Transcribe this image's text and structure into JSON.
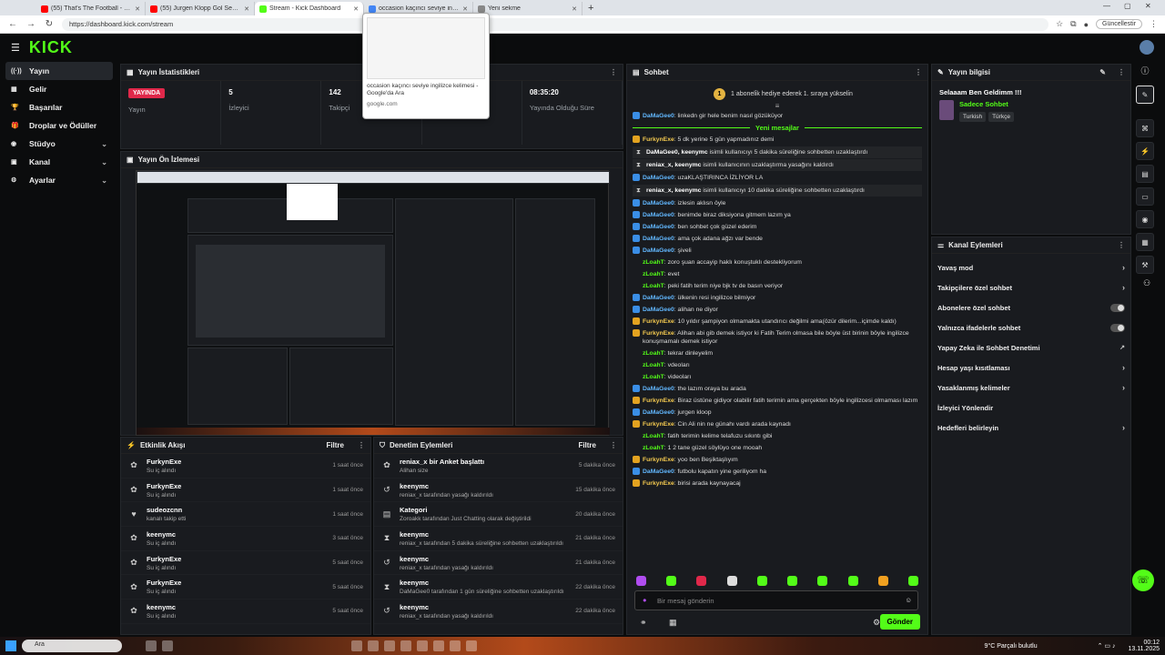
{
  "browser": {
    "tabs": [
      {
        "title": "(55) That's The Football - Fatih Te...",
        "color": "#ff0000",
        "active": false
      },
      {
        "title": "(55) Jurgen Klopp Gol Sevinci #kl...",
        "color": "#ff0000",
        "active": false
      },
      {
        "title": "Stream - Kick Dashboard",
        "color": "#53fc18",
        "active": true
      },
      {
        "title": "occasion kaçıncı seviye ingilizce k...",
        "color": "#4285f4",
        "active": false
      },
      {
        "title": "Yeni sekme",
        "color": "#888888",
        "active": false
      }
    ],
    "url": "https://dashboard.kick.com/stream",
    "update_label": "Güncellestir",
    "hover_card": {
      "title": "occasion kaçıncı seviye ingilizce kelimesi - Google'da Ara",
      "domain": "google.com"
    }
  },
  "brand": {
    "logo": "KICK",
    "accent": "#53fc18"
  },
  "sidebar": {
    "items": [
      {
        "label": "Yayın",
        "icon": "broadcast-icon",
        "glyph": "((·))",
        "active": true,
        "chev": ""
      },
      {
        "label": "Gelir",
        "icon": "revenue-icon",
        "glyph": "▦",
        "active": false,
        "chev": ""
      },
      {
        "label": "Başarılar",
        "icon": "trophy-icon",
        "glyph": "🏆",
        "active": false,
        "chev": ""
      },
      {
        "label": "Droplar ve Ödüller",
        "icon": "gift-icon",
        "glyph": "🎁",
        "active": false,
        "chev": ""
      },
      {
        "label": "Stüdyo",
        "icon": "studio-icon",
        "glyph": "◉",
        "active": false,
        "chev": "⌄"
      },
      {
        "label": "Kanal",
        "icon": "channel-icon",
        "glyph": "▣",
        "active": false,
        "chev": "⌄"
      },
      {
        "label": "Ayarlar",
        "icon": "settings-icon",
        "glyph": "⚙",
        "active": false,
        "chev": "⌄"
      }
    ]
  },
  "stats_panel": {
    "title": "Yayın İstatistikleri",
    "live_badge": "YAYINDA",
    "items": [
      {
        "value": "",
        "label": "Yayın"
      },
      {
        "value": "5",
        "label": "İzleyici"
      },
      {
        "value": "142",
        "label": "Takipçi"
      },
      {
        "value": "",
        "label": ""
      },
      {
        "value": "08:35:20",
        "label": "Yayında Olduğu Süre"
      }
    ]
  },
  "preview_panel": {
    "title": "Yayın Ön İzlemesi"
  },
  "activity_panel": {
    "title": "Etkinlik Akışı",
    "filter": "Filtre",
    "rows": [
      {
        "name": "FurkynExe",
        "detail": "Su iç alındı",
        "time": "1 saat önce",
        "icon": "reward-icon",
        "glyph": "✿"
      },
      {
        "name": "FurkynExe",
        "detail": "Su iç alındı",
        "time": "1 saat önce",
        "icon": "reward-icon",
        "glyph": "✿"
      },
      {
        "name": "sudeozcnn",
        "detail": "kanalı takip etti",
        "time": "1 saat önce",
        "icon": "heart-icon",
        "glyph": "♥"
      },
      {
        "name": "keenymc",
        "detail": "Su iç alındı",
        "time": "3 saat önce",
        "icon": "reward-icon",
        "glyph": "✿"
      },
      {
        "name": "FurkynExe",
        "detail": "Su iç alındı",
        "time": "5 saat önce",
        "icon": "reward-icon",
        "glyph": "✿"
      },
      {
        "name": "FurkynExe",
        "detail": "Su iç alındı",
        "time": "5 saat önce",
        "icon": "reward-icon",
        "glyph": "✿"
      },
      {
        "name": "keenymc",
        "detail": "Su iç alındı",
        "time": "5 saat önce",
        "icon": "reward-icon",
        "glyph": "✿"
      }
    ]
  },
  "moderation_panel": {
    "title": "Denetim Eylemleri",
    "filter": "Filtre",
    "rows": [
      {
        "name": "reniax_x bir Anket başlattı",
        "detail": "Alihan size",
        "time": "5 dakika önce",
        "icon": "poll-icon",
        "glyph": "✿"
      },
      {
        "name": "keenymc",
        "detail": "reniax_x tarafından yasağı kaldırıldı",
        "time": "15 dakika önce",
        "icon": "unban-icon",
        "glyph": "↺"
      },
      {
        "name": "Kategori",
        "detail": "Zoroakk tarafından Just Chatting olarak değiştirildi",
        "time": "20 dakika önce",
        "icon": "category-icon",
        "glyph": "▤"
      },
      {
        "name": "keenymc",
        "detail": "reniax_x tarafından 5 dakika süreliğine sohbetten uzaklaştırıldı",
        "time": "21 dakika önce",
        "icon": "timeout-icon",
        "glyph": "⧗"
      },
      {
        "name": "keenymc",
        "detail": "reniax_x tarafından yasağı kaldırıldı",
        "time": "21 dakika önce",
        "icon": "unban-icon",
        "glyph": "↺"
      },
      {
        "name": "keenymc",
        "detail": "DaMaGee0 tarafından 1 gün süreliğine sohbetten uzaklaştırıldı",
        "time": "22 dakika önce",
        "icon": "timeout-icon",
        "glyph": "⧗"
      },
      {
        "name": "keenymc",
        "detail": "reniax_x tarafından yasağı kaldırıldı",
        "time": "22 dakika önce",
        "icon": "unban-icon",
        "glyph": "↺"
      }
    ]
  },
  "chat_panel": {
    "title": "Sohbet",
    "banner": "1 aboneli̇k hediye ederek 1. sıraya yükseli̇n",
    "banner_num": "1",
    "new_messages": "Yeni mesajlar",
    "input_placeholder": "Bir mesaj gönderin",
    "send_label": "Gönder",
    "messages_before": [
      {
        "user": "DaMaGee0",
        "text": "linkedn gir hele benim nasıl gözüküyor",
        "style": "blue",
        "sys": false
      }
    ],
    "messages": [
      {
        "user": "FurkynExe",
        "text": "5 dk yerine 5 gün yapmadınız demi",
        "style": "gold",
        "sys": false
      },
      {
        "user": "DaMaGee0, keenymc",
        "text": "isimli kullanıcıyı 5 dakika süreliğine sohbetten uzaklaştırdı",
        "style": "plain",
        "sys": true
      },
      {
        "user": "reniax_x, keenymc",
        "text": "isimli kullanıcının uzaklaştırma yasağını kaldırdı",
        "style": "plain",
        "sys": true
      },
      {
        "user": "DaMaGee0",
        "text": "uzaKLAŞTIRINCA İZLİYOR LA",
        "style": "blue",
        "sys": false
      },
      {
        "user": "reniax_x, keenymc",
        "text": "isimli kullanıcıyı 10 dakika süreliğine sohbetten uzaklaştırdı",
        "style": "plain",
        "sys": true
      },
      {
        "user": "DaMaGee0",
        "text": "izlesin aklısn öyle",
        "style": "blue",
        "sys": false
      },
      {
        "user": "DaMaGee0",
        "text": "benimde biraz diksiyona gitmem lazım ya",
        "style": "blue",
        "sys": false
      },
      {
        "user": "DaMaGee0",
        "text": "ben sohbet çok güzel ederim",
        "style": "blue",
        "sys": false
      },
      {
        "user": "DaMaGee0",
        "text": "ama çok adana ağzı var bende",
        "style": "blue",
        "sys": false
      },
      {
        "user": "DaMaGee0",
        "text": "şiveli",
        "style": "blue",
        "sys": false
      },
      {
        "user": "zLoahT",
        "text": "zoro şuan accayip haklı konuştuklı destekliyorum",
        "style": "green",
        "sys": false
      },
      {
        "user": "zLoahT",
        "text": "evet",
        "style": "green",
        "sys": false
      },
      {
        "user": "zLoahT",
        "text": "peki fatih terim niye bjk tv de basın veriyor",
        "style": "green",
        "sys": false
      },
      {
        "user": "DaMaGee0",
        "text": "ülkenin resi ingilizce bilmiyor",
        "style": "blue",
        "sys": false
      },
      {
        "user": "DaMaGee0",
        "text": "alihan ne diyor",
        "style": "blue",
        "sys": false
      },
      {
        "user": "FurkynExe",
        "text": "10 yıldır şampiyon olmamakta utandırıcı değilmi ama(özür dilerim...içimde kaldı)",
        "style": "gold",
        "sys": false
      },
      {
        "user": "FurkynExe",
        "text": "Alihan abi gib demek istiyor ki Fatih Terim olmasa bile böyle üst birinin böyle ingilizce konuşmamalı demek istiyor",
        "style": "gold",
        "sys": false
      },
      {
        "user": "zLoahT",
        "text": "tekrar dinleyelim",
        "style": "green",
        "sys": false
      },
      {
        "user": "zLoahT",
        "text": "vdeoları",
        "style": "green",
        "sys": false
      },
      {
        "user": "zLoahT",
        "text": "videoları",
        "style": "green",
        "sys": false
      },
      {
        "user": "DaMaGee0",
        "text": "the lazım oraya bu arada",
        "style": "blue",
        "sys": false
      },
      {
        "user": "FurkynExe",
        "text": "Biraz üstüne gidiyor olabilir fatih terimin ama gerçekten böyle ingilizcesi olmaması lazım",
        "style": "gold",
        "sys": false
      },
      {
        "user": "DaMaGee0",
        "text": "jurgen kloop",
        "style": "blue",
        "sys": false
      },
      {
        "user": "FurkynExe",
        "text": "Cin Ali nin ne günahı vardı arada kaynadı",
        "style": "gold",
        "sys": false
      },
      {
        "user": "zLoahT",
        "text": "fatih terimin kelime telafuzu sıkıntı gibi",
        "style": "green",
        "sys": false
      },
      {
        "user": "zLoahT",
        "text": "1 2 tane güzel söylüyo one mooah",
        "style": "green",
        "sys": false
      },
      {
        "user": "FurkynExe",
        "text": "yoo ben Beşiktaşlıyım",
        "style": "gold",
        "sys": false
      },
      {
        "user": "DaMaGee0",
        "text": "futbolu kapatın yine geriliyom ha",
        "style": "blue",
        "sys": false
      },
      {
        "user": "FurkynExe",
        "text": "birisi arada kaynayacaj",
        "style": "gold",
        "sys": false
      }
    ],
    "emote_colors": [
      "#b04df0",
      "#53fc18",
      "#e0284a",
      "#dddddd",
      "#53fc18",
      "#53fc18",
      "#53fc18",
      "#53fc18",
      "#f0a020",
      "#53fc18"
    ]
  },
  "stream_info": {
    "title": "Yayın bilgisi",
    "stream_title": "Selaaam Ben Geldimm !!!",
    "category": "Sadece Sohbet",
    "tags": [
      "Turkish",
      "Türkçe"
    ]
  },
  "channel_actions": {
    "title": "Kanal Eylemleri",
    "items": [
      {
        "label": "Yavaş mod",
        "kind": "arrow"
      },
      {
        "label": "Takipçilere özel sohbet",
        "kind": "arrow"
      },
      {
        "label": "Abonelere özel sohbet",
        "kind": "toggle"
      },
      {
        "label": "Yalnızca ifadelerle sohbet",
        "kind": "toggle"
      },
      {
        "label": "Yapay Zeka ile Sohbet Denetimi",
        "kind": "ext"
      },
      {
        "label": "Hesap yaşı kısıtlaması",
        "kind": "arrow"
      },
      {
        "label": "Yasaklanmış kelimeler",
        "kind": "arrow"
      },
      {
        "label": "İzleyici Yönlendir",
        "kind": "none"
      },
      {
        "label": "Hedefleri belirleyin",
        "kind": "arrow"
      }
    ]
  },
  "taskbar": {
    "search": "Ara",
    "weather": "9°C Parçalı bulutlu",
    "time": "00:12",
    "date": "13.11.2025"
  }
}
